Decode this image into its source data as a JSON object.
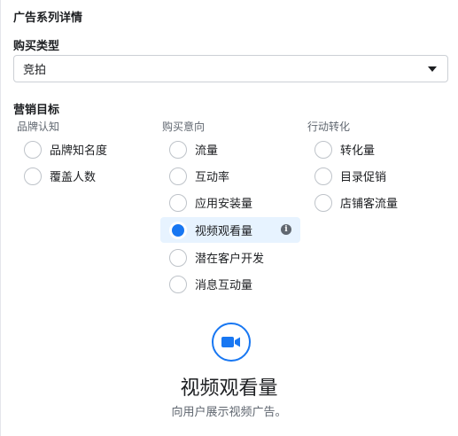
{
  "panel": {
    "title": "广告系列详情"
  },
  "buying_type": {
    "label": "购买类型",
    "selected": "竞拍"
  },
  "objective": {
    "label": "营销目标",
    "groups": [
      {
        "header": "品牌认知",
        "options": [
          "品牌知名度",
          "覆盖人数"
        ]
      },
      {
        "header": "购买意向",
        "options": [
          "流量",
          "互动率",
          "应用安装量",
          "视频观看量",
          "潜在客户开发",
          "消息互动量"
        ]
      },
      {
        "header": "行动转化",
        "options": [
          "转化量",
          "目录促销",
          "店铺客流量"
        ]
      }
    ],
    "selected_option": "视频观看量"
  },
  "summary": {
    "icon": "video-camera-icon",
    "title": "视频观看量",
    "description": "向用户展示视频广告。"
  },
  "colors": {
    "accent": "#1877f2",
    "selected_bg": "#e7f3ff",
    "border": "#ccd0d5",
    "muted_text": "#606770"
  }
}
